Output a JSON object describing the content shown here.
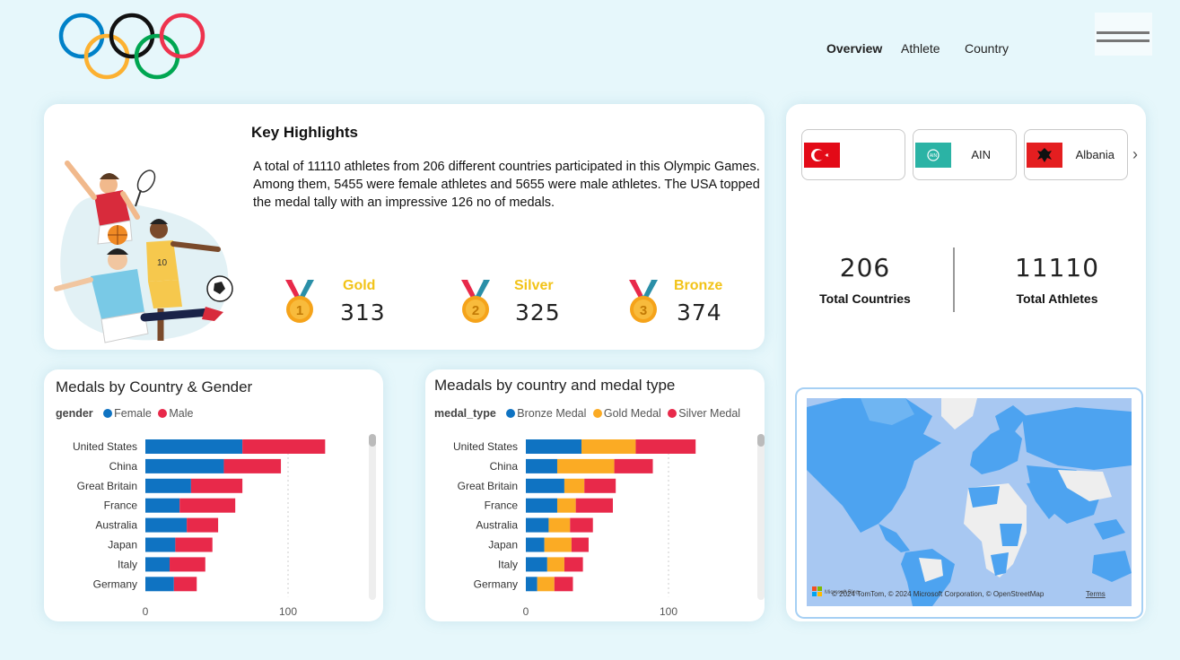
{
  "nav": {
    "items": [
      "Overview",
      "Athlete",
      "Country"
    ],
    "active": "Overview"
  },
  "highlights": {
    "title": "Key Highlights",
    "text": "A total of 11110 athletes from 206 different countries participated in this Olympic Games. Among them, 5455 were female athletes and 5655 were male athletes. The USA topped the medal tally with an impressive 126 no of medals.",
    "medals": [
      {
        "label": "Gold",
        "value": "313",
        "number": "1"
      },
      {
        "label": "Silver",
        "value": "325",
        "number": "2"
      },
      {
        "label": "Bronze",
        "value": "374",
        "number": "3"
      }
    ]
  },
  "country_slicer": {
    "cards": [
      {
        "name": "",
        "flag": "turkey-flag"
      },
      {
        "name": "AIN",
        "flag": "ain-flag"
      },
      {
        "name": "Albania",
        "flag": "albania-flag"
      }
    ]
  },
  "kpis": {
    "countries_value": "206",
    "countries_label": "Total Countries",
    "athletes_value": "11110",
    "athletes_label": "Total Athletes"
  },
  "map": {
    "attribution": "© 2024 TomTom, © 2024 Microsoft Corporation, © OpenStreetMap",
    "terms": "Terms",
    "logo_text": "Microsoft Bing"
  },
  "colors": {
    "female": "#0f73c2",
    "male": "#e8294a",
    "bronze": "#0f73c2",
    "gold": "#fbab24",
    "silver": "#e8294a",
    "gold_label": "#f2c318",
    "ocean": "#a8c8f2",
    "land_highlight": "#4da3f0",
    "land_other": "#eeeeee"
  },
  "chart_data": [
    {
      "type": "bar",
      "orientation": "horizontal",
      "stacked": true,
      "title": "Medals by Country & Gender",
      "legend_title": "gender",
      "legend_position": "top-left",
      "categories": [
        "United States",
        "China",
        "Great Britain",
        "France",
        "Australia",
        "Japan",
        "Italy",
        "Germany"
      ],
      "series": [
        {
          "name": "Female",
          "values": [
            68,
            55,
            32,
            24,
            29,
            21,
            17,
            20
          ]
        },
        {
          "name": "Male",
          "values": [
            58,
            40,
            36,
            39,
            22,
            26,
            25,
            16
          ]
        }
      ],
      "xticks": [
        0,
        100
      ],
      "xlim": [
        0,
        130
      ],
      "grid": false
    },
    {
      "type": "bar",
      "orientation": "horizontal",
      "stacked": true,
      "title": "Meadals by country and medal type",
      "legend_title": "medal_type",
      "legend_position": "top-left",
      "categories": [
        "United States",
        "China",
        "Great Britain",
        "France",
        "Australia",
        "Japan",
        "Italy",
        "Germany"
      ],
      "series": [
        {
          "name": "Bronze Medal",
          "values": [
            39,
            22,
            27,
            22,
            16,
            13,
            15,
            8
          ]
        },
        {
          "name": "Gold Medal",
          "values": [
            38,
            40,
            14,
            13,
            15,
            19,
            12,
            12
          ]
        },
        {
          "name": "Silver Medal",
          "values": [
            42,
            27,
            22,
            26,
            16,
            12,
            13,
            13
          ]
        }
      ],
      "xticks": [
        0,
        100
      ],
      "xlim": [
        0,
        130
      ],
      "grid": false
    }
  ]
}
